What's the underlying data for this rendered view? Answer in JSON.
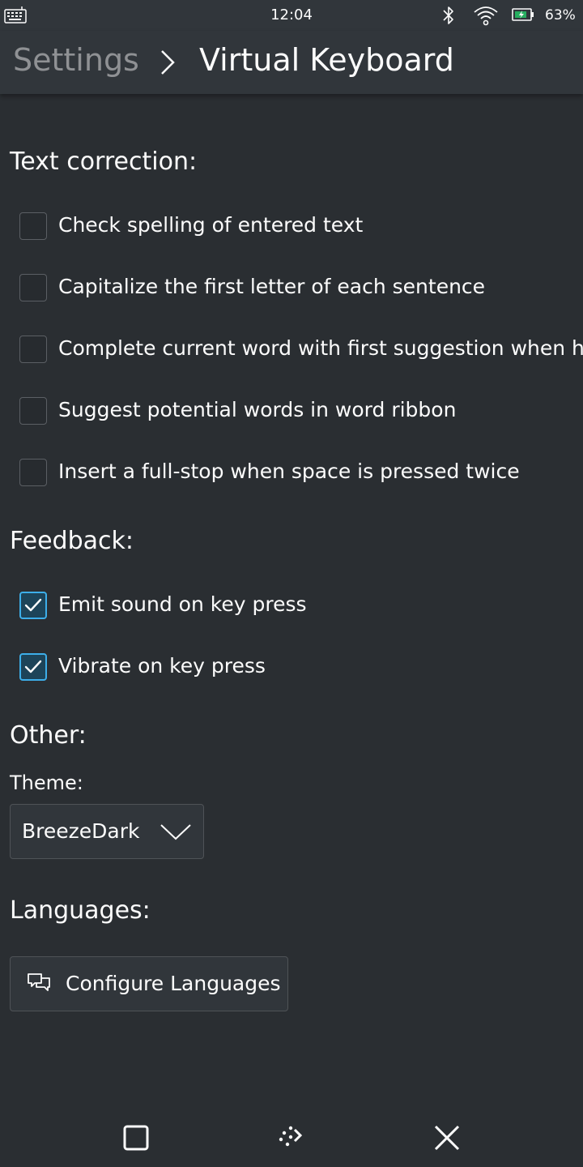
{
  "status_bar": {
    "time": "12:04",
    "battery": "63%",
    "icons": [
      "keyboard-icon",
      "bluetooth-icon",
      "wifi-icon",
      "battery-icon"
    ]
  },
  "header": {
    "breadcrumb_parent": "Settings",
    "breadcrumb_current": "Virtual Keyboard"
  },
  "sections": {
    "text_correction": {
      "title": "Text correction:",
      "options": [
        {
          "label": "Check spelling of entered text",
          "checked": false
        },
        {
          "label": "Capitalize the first letter of each sentence",
          "checked": false
        },
        {
          "label": "Complete current word with first suggestion when hit",
          "checked": false
        },
        {
          "label": "Suggest potential words in word ribbon",
          "checked": false
        },
        {
          "label": "Insert a full-stop when space is pressed twice",
          "checked": false
        }
      ]
    },
    "feedback": {
      "title": "Feedback:",
      "options": [
        {
          "label": "Emit sound on key press",
          "checked": true
        },
        {
          "label": "Vibrate on key press",
          "checked": true
        }
      ]
    },
    "other": {
      "title": "Other:",
      "theme_label": "Theme:",
      "theme_value": "BreezeDark"
    },
    "languages": {
      "title": "Languages:",
      "configure_button": "Configure Languages"
    }
  },
  "colors": {
    "background": "#2a2e32",
    "header": "#31363b",
    "accent": "#3daee9",
    "text": "#fcfcfc",
    "muted_text": "#8f9194"
  }
}
